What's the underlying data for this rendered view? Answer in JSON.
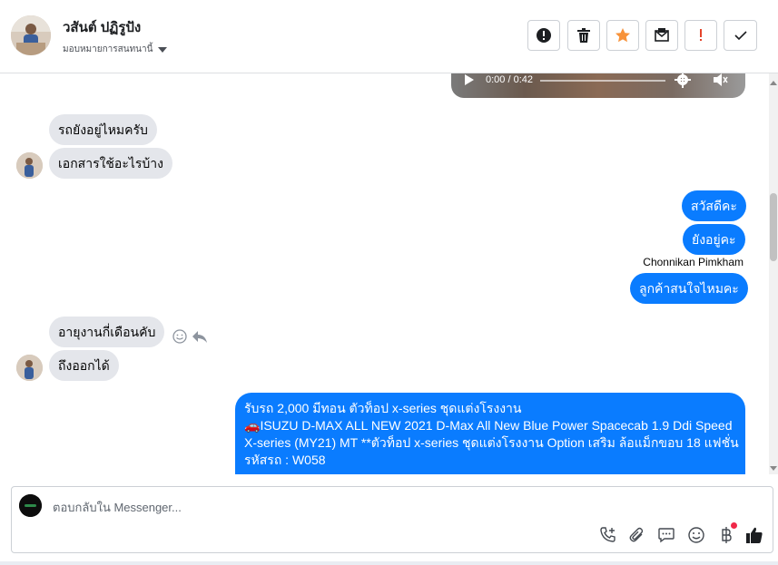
{
  "header": {
    "contact_name": "วสันต์ ปฏิรูปัง",
    "assign_label": "มอบหมายการสนทนานี้",
    "toolbar": {
      "alert_icon": "exclamation-circle-icon",
      "delete_icon": "trash-icon",
      "star_icon": "star-icon",
      "unread_icon": "envelope-icon",
      "spam_icon": "exclamation-icon",
      "done_icon": "check-icon"
    }
  },
  "messages": {
    "video": {
      "time": "0:00 / 0:42"
    },
    "incoming_1": [
      "รถยังอยู่ไหมครับ",
      "เอกสารใช้อะไรบ้าง"
    ],
    "outgoing_1": [
      "สวัสดีคะ",
      "ยังอยู่คะ"
    ],
    "sender_name": "Chonnikan Pimkham",
    "outgoing_2": "ลูกค้าสนใจไหมคะ",
    "incoming_2": [
      "อายุงานกี่เดือนคับ",
      "ถึงออกได้"
    ],
    "long_message": {
      "line1": "รับรถ 2,000 มีทอน ตัวท็อป x-series ชุดแต่งโรงงาน",
      "line2_emoji": "🚗",
      "line2": "ISUZU D-MAX ALL NEW 2021 D-Max All New Blue Power Spacecab 1.9 Ddi Speed",
      "line3": "X-series (MY21) MT **ตัวท็อป x-series ชุดแต่งโรงงาน Option เสริม ล้อแม็กขอบ 18 แฟชั่น",
      "line4": "รหัสรถ : W058"
    }
  },
  "reply": {
    "placeholder": "ตอบกลับใน Messenger..."
  },
  "colors": {
    "outgoing": "#0a7cff",
    "incoming": "#e4e6eb",
    "star": "#f7923a",
    "spam": "#e4442b"
  }
}
